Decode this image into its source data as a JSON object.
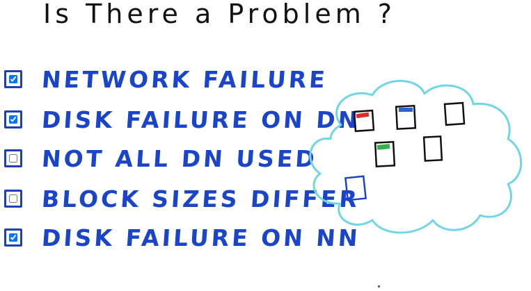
{
  "title": "Is There a Problem ?",
  "checklist": [
    {
      "label": "NETWORK FAILURE",
      "checked": true
    },
    {
      "label": "DISK FAILURE ON DN",
      "checked": true
    },
    {
      "label": "NOT ALL DN USED",
      "checked": false
    },
    {
      "label": "BLOCK SIZES DIFFER",
      "checked": false
    },
    {
      "label": "DISK FAILURE ON NN",
      "checked": true
    }
  ],
  "colors": {
    "ink_blue": "#1a44c9",
    "cloud": "#6fd6e6",
    "block_red": "#e02a2a",
    "block_blue": "#2a62d6",
    "block_green": "#34b24a"
  }
}
